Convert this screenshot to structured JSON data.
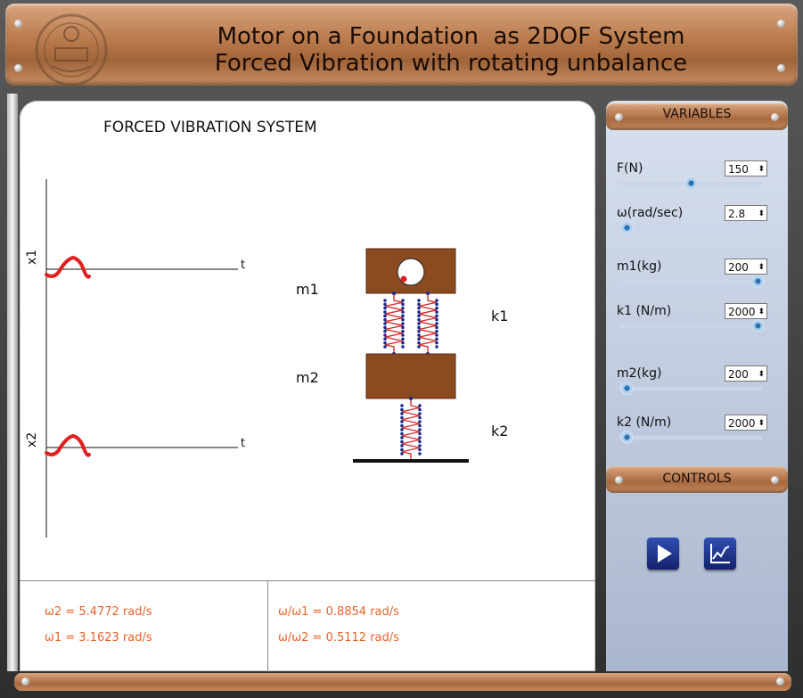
{
  "header": {
    "title_line1": "Motor on a Foundation  as 2DOF System",
    "title_line2": "Forced Vibration with rotating unbalance",
    "logo": "institute-seal-logo"
  },
  "main": {
    "title": "FORCED VIBRATION SYSTEM",
    "graph": {
      "y1_label": "x1",
      "y2_label": "x2",
      "t_label": "t"
    },
    "diagram": {
      "m1_label": "m1",
      "m2_label": "m2",
      "k1_label": "k1",
      "k2_label": "k2"
    },
    "results": {
      "w2": "ω2 = 5.4772 rad/s",
      "w1": "ω1 = 3.1623 rad/s",
      "ratio1": "ω/ω1 = 0.8854 rad/s",
      "ratio2": "ω/ω2 = 0.5112 rad/s"
    }
  },
  "panel": {
    "variables_title": "VARIABLES",
    "controls_title": "CONTROLS",
    "variables": [
      {
        "label": "F(N)",
        "value": "150",
        "level": 0.5
      },
      {
        "label": "ω(rad/sec)",
        "value": "2.8",
        "level": 0.05
      },
      {
        "label": "m1(kg)",
        "value": "200",
        "level": 0.97
      },
      {
        "label": "k1 (N/m)",
        "value": "2000",
        "level": 0.97
      },
      {
        "label": "m2(kg)",
        "value": "200",
        "level": 0.05
      },
      {
        "label": "k2 (N/m)",
        "value": "2000",
        "level": 0.05
      }
    ],
    "controls": {
      "play_icon": "play-icon",
      "graph_icon": "chart-icon"
    }
  },
  "colors": {
    "accent_copper": "#b97a4c",
    "result_text": "#e8632a",
    "wave": "#e02020",
    "mass": "#8b4a1f",
    "spring": "#d03030"
  }
}
